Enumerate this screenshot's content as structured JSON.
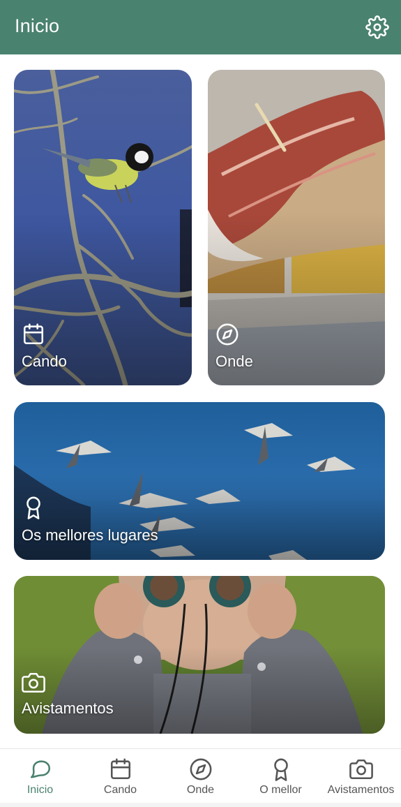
{
  "header": {
    "title": "Inicio",
    "settings_icon": "gear-icon",
    "background": "#4a8270"
  },
  "cards": {
    "cando": {
      "label": "Cando",
      "icon": "calendar-icon",
      "image": "great tit bird on branch"
    },
    "onde": {
      "label": "Onde",
      "icon": "compass-icon",
      "image": "ham on bread tapa"
    },
    "lugares": {
      "label": "Os mellores lugares",
      "icon": "award-icon",
      "image": "shorebirds flying over sea"
    },
    "avistamentos": {
      "label": "Avistamentos",
      "icon": "camera-icon",
      "image": "child with binoculars"
    }
  },
  "nav": {
    "items": [
      {
        "label": "Inicio",
        "icon": "chat-bubble-icon",
        "active": true
      },
      {
        "label": "Cando",
        "icon": "calendar-icon",
        "active": false
      },
      {
        "label": "Onde",
        "icon": "compass-icon",
        "active": false
      },
      {
        "label": "O mellor",
        "icon": "award-icon",
        "active": false
      },
      {
        "label": "Avistamentos",
        "icon": "camera-icon",
        "active": false
      }
    ],
    "active_color": "#4a8270",
    "inactive_color": "#555555"
  }
}
